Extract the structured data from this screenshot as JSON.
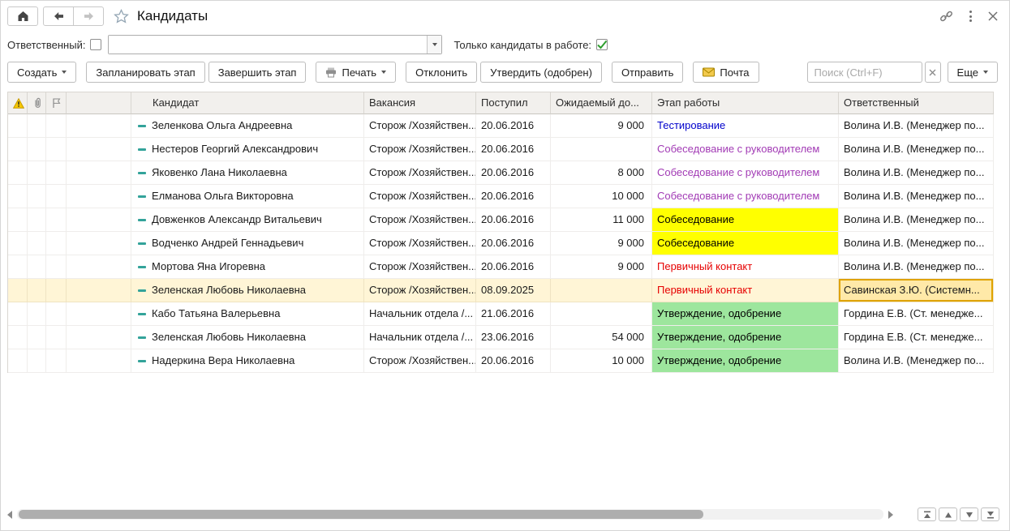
{
  "window": {
    "title": "Кандидаты"
  },
  "filter_bar": {
    "responsible_label": "Ответственный:",
    "responsible_checked": false,
    "responsible_value": "",
    "in_work_label": "Только кандидаты в работе:",
    "in_work_checked": true
  },
  "toolbar": {
    "create_label": "Создать",
    "plan_stage_label": "Запланировать этап",
    "finish_stage_label": "Завершить этап",
    "print_label": "Печать",
    "decline_label": "Отклонить",
    "approve_label": "Утвердить (одобрен)",
    "send_label": "Отправить",
    "mail_label": "Почта",
    "search_placeholder": "Поиск (Ctrl+F)",
    "search_value": "",
    "more_label": "Еще"
  },
  "table": {
    "headers": {
      "candidate": "Кандидат",
      "vacancy": "Вакансия",
      "received": "Поступил",
      "expected": "Ожидаемый до...",
      "stage": "Этап работы",
      "responsible": "Ответственный"
    },
    "rows": [
      {
        "candidate": "Зеленкова Ольга Андреевна",
        "vacancy": "Сторож /Хозяйствен...",
        "received": "20.06.2016",
        "expected": "9 000",
        "stage": "Тестирование",
        "stage_variant": "blue",
        "responsible": "Волина И.В. (Менеджер по...",
        "selected": false,
        "resp_focused": false
      },
      {
        "candidate": "Нестеров Георгий Александрович",
        "vacancy": "Сторож /Хозяйствен...",
        "received": "20.06.2016",
        "expected": "",
        "stage": "Собеседование с руководителем",
        "stage_variant": "purple",
        "responsible": "Волина И.В. (Менеджер по...",
        "selected": false,
        "resp_focused": false
      },
      {
        "candidate": "Яковенко Лана Николаевна",
        "vacancy": "Сторож /Хозяйствен...",
        "received": "20.06.2016",
        "expected": "8 000",
        "stage": "Собеседование с руководителем",
        "stage_variant": "purple",
        "responsible": "Волина И.В. (Менеджер по...",
        "selected": false,
        "resp_focused": false
      },
      {
        "candidate": "Елманова Ольга Викторовна",
        "vacancy": "Сторож /Хозяйствен...",
        "received": "20.06.2016",
        "expected": "10 000",
        "stage": "Собеседование с руководителем",
        "stage_variant": "purple",
        "responsible": "Волина И.В. (Менеджер по...",
        "selected": false,
        "resp_focused": false
      },
      {
        "candidate": "Довженков Александр Витальевич",
        "vacancy": "Сторож /Хозяйствен...",
        "received": "20.06.2016",
        "expected": "11 000",
        "stage": "Собеседование",
        "stage_variant": "yellow",
        "responsible": "Волина И.В. (Менеджер по...",
        "selected": false,
        "resp_focused": false
      },
      {
        "candidate": "Водченко Андрей Геннадьевич",
        "vacancy": "Сторож /Хозяйствен...",
        "received": "20.06.2016",
        "expected": "9 000",
        "stage": "Собеседование",
        "stage_variant": "yellow",
        "responsible": "Волина И.В. (Менеджер по...",
        "selected": false,
        "resp_focused": false
      },
      {
        "candidate": "Мортова Яна Игоревна",
        "vacancy": "Сторож /Хозяйствен...",
        "received": "20.06.2016",
        "expected": "9 000",
        "stage": "Первичный контакт",
        "stage_variant": "red",
        "responsible": "Волина И.В. (Менеджер по...",
        "selected": false,
        "resp_focused": false
      },
      {
        "candidate": "Зеленская Любовь Николаевна",
        "vacancy": "Сторож /Хозяйствен...",
        "received": "08.09.2025",
        "expected": "",
        "stage": "Первичный контакт",
        "stage_variant": "red",
        "responsible": "Савинская З.Ю. (Системн...",
        "selected": true,
        "resp_focused": true
      },
      {
        "candidate": "Кабо Татьяна Валерьевна",
        "vacancy": "Начальник отдела /...",
        "received": "21.06.2016",
        "expected": "",
        "stage": "Утверждение, одобрение",
        "stage_variant": "green",
        "responsible": "Гордина Е.В. (Ст. менедже...",
        "selected": false,
        "resp_focused": false
      },
      {
        "candidate": "Зеленская Любовь Николаевна",
        "vacancy": "Начальник отдела /...",
        "received": "23.06.2016",
        "expected": "54 000",
        "stage": "Утверждение, одобрение",
        "stage_variant": "green",
        "responsible": "Гордина Е.В. (Ст. менедже...",
        "selected": false,
        "resp_focused": false
      },
      {
        "candidate": "Надеркина Вера Николаевна",
        "vacancy": "Сторож /Хозяйствен...",
        "received": "20.06.2016",
        "expected": "10 000",
        "stage": "Утверждение, одобрение",
        "stage_variant": "green",
        "responsible": "Волина И.В. (Менеджер по...",
        "selected": false,
        "resp_focused": false
      }
    ]
  },
  "icons": {
    "home": "house",
    "back": "arrow-left",
    "forward": "arrow-right",
    "favorite": "star-outline",
    "link": "chain-link",
    "menu": "vertical-ellipsis",
    "close": "x-cross",
    "print": "printer",
    "mail": "envelope",
    "search_clear": "x-cross",
    "warning_column": "warning-triangle",
    "attachment_column": "paperclip",
    "flag_column": "flag",
    "row_state": "teal-dash",
    "list_first": "triangle-up-bar",
    "list_up": "triangle-up",
    "list_down": "triangle-down",
    "list_last": "triangle-down-bar"
  },
  "colors": {
    "stage_blue": "#0000cc",
    "stage_purple": "#a23bb5",
    "stage_red": "#e60000",
    "stage_yellow_bg": "#ffff00",
    "stage_green_bg": "#9de69d",
    "selected_row_bg": "#fff5d6",
    "focused_cell_bg": "#ffe9a8",
    "focused_cell_border": "#dfa300"
  }
}
